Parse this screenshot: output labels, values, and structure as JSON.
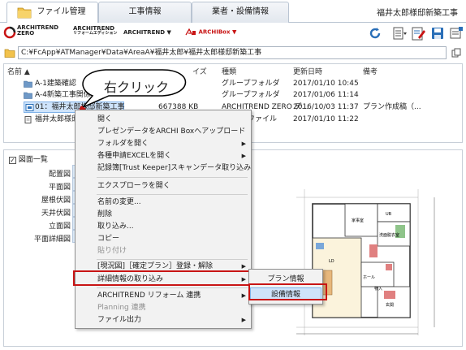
{
  "tabs": [
    {
      "label": "ファイル管理",
      "active": true
    },
    {
      "label": "工事情報",
      "active": false
    },
    {
      "label": "業者・設備情報",
      "active": false
    }
  ],
  "project_title": "福井太郎様邸新築工事",
  "toolbar": {
    "logo_architrend_zero": "ARCHITREND",
    "logo_architrend_zero_sub": "ZERO",
    "logo_reform": "ARCHITREND",
    "logo_reform_sub": "リフォームエディション",
    "menu_architrend": "ARCHITREND ▼",
    "menu_archibox": "ARCHIBox ▼"
  },
  "path": "C:¥FcApp¥ATManager¥Data¥AreaA¥福井太郎¥福井太郎様邸新築工事",
  "file_list": {
    "columns": {
      "name": "名前 ▲",
      "size": "イズ",
      "type": "種類",
      "updated": "更新日時",
      "note": "備考"
    },
    "rows": [
      {
        "name": "A-1建築確認",
        "size": "",
        "type": "グループフォルダ",
        "updated": "2017/01/10 10:45",
        "note": ""
      },
      {
        "name": "A-4新築工事関係",
        "size": "",
        "type": "グループフォルダ",
        "updated": "2017/01/06 11:14",
        "note": ""
      },
      {
        "name": "01：福井太郎様邸新築工事",
        "size": "667388 KB",
        "type": "ARCHITREND ZERO デ...",
        "updated": "2016/10/03 11:37",
        "note": "プラン作成稿（..."
      },
      {
        "name": "福井太郎様邸",
        "size": "",
        "type": "ファイル",
        "updated": "2017/01/10 11:22",
        "note": ""
      }
    ]
  },
  "callout": "右クリック",
  "lower_panel": {
    "checkbox_label": "図面一覧",
    "views": [
      "配置図",
      "平面図",
      "屋根伏図",
      "天井伏図",
      "立面図",
      "平面詳細図"
    ]
  },
  "context_menu": {
    "items": [
      {
        "label": "開く",
        "disabled": false,
        "arrow": false
      },
      {
        "label": "プレゼンデータをARCHI Boxへアップロード",
        "disabled": false,
        "arrow": false
      },
      {
        "label": "フォルダを開く",
        "disabled": false,
        "arrow": true
      },
      {
        "label": "各種申請EXCELを開く",
        "disabled": false,
        "arrow": true
      },
      {
        "label": "記録簿[Trust Keeper]スキャンデータ取り込み",
        "disabled": false,
        "arrow": false
      },
      {
        "label": "エクスプローラを開く",
        "disabled": false,
        "arrow": false
      },
      {
        "label": "名前の変更...",
        "disabled": false,
        "arrow": false
      },
      {
        "label": "削除",
        "disabled": false,
        "arrow": false
      },
      {
        "label": "取り込み...",
        "disabled": false,
        "arrow": false
      },
      {
        "label": "コピー",
        "disabled": false,
        "arrow": false
      },
      {
        "label": "貼り付け",
        "disabled": true,
        "arrow": false
      },
      {
        "label": "[現況図]［確定プラン］登録・解除",
        "disabled": false,
        "arrow": true
      },
      {
        "label": "詳細情報の取り込み",
        "disabled": false,
        "arrow": true
      },
      {
        "label": "ARCHITREND リフォーム 連携",
        "disabled": false,
        "arrow": true
      },
      {
        "label": "Planning 連携",
        "disabled": true,
        "arrow": false
      },
      {
        "label": "ファイル出力",
        "disabled": false,
        "arrow": true
      }
    ]
  },
  "submenu": {
    "items": [
      "プラン情報",
      "設備情報"
    ]
  },
  "floorplan_labels": {
    "room1": "家事室",
    "room2": "洗面脱衣室",
    "room3": "浴室",
    "room4": "玄関",
    "room5": "ホール",
    "room6": "物入",
    "room7": "LD",
    "room8": "UB"
  },
  "colors": {
    "accent_red": "#c81414",
    "selection_blue": "#cfe4fb",
    "folder_yellow": "#f2c24c"
  }
}
